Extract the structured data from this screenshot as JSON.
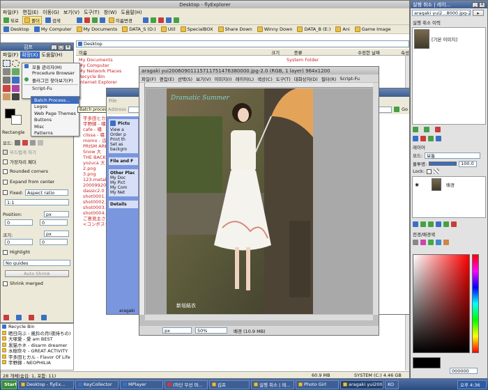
{
  "explorer": {
    "title": "Desktop - flyExplorer",
    "menu": [
      "파일(F)",
      "편집(E)",
      "이동(G)",
      "보기(V)",
      "도구(T)",
      "창(W)",
      "도움말(H)"
    ],
    "toolbar": [
      "뒤로",
      "폴더",
      "검색",
      "이름변경"
    ],
    "favorites": [
      "Desktop",
      "My Computer",
      "My Documents",
      "DATA_S (D:)",
      "Util",
      "SpecialBOX",
      "Share Down",
      "Winny Down",
      "DATA_B (E:)",
      "Ani",
      "Game Image"
    ],
    "address": "Desktop",
    "columns": [
      "이름",
      "크기",
      "종류",
      "수정한 날짜",
      "속성"
    ],
    "first_row_type": "System Folder",
    "files": [
      "My Documents",
      "My Computer",
      "My Network Places",
      "Recycle Bin",
      "Internet Explorer"
    ],
    "lower_files": [
      "宇多田ヒカル",
      "宇野錦 - 嘯",
      "cafe - 嘯",
      "clissa - 嘯",
      "momo - 瓜",
      "PRISM ARK",
      "Snow 大",
      "THE BACK",
      "yozuca 大",
      "2.png",
      "3.png",
      "123-metalo",
      "2000992022",
      "dassic2.0",
      "shot0001.pr",
      "shot0002.pr",
      "shot0003.pr",
      "shot0004.pr",
      "ご意見主さ",
      "<コンボスクリ"
    ],
    "status_left": "28 개체(숨김: 1, 포함: 11)",
    "status_size": "60.9 MB",
    "status_drive": "SYSTEM (C:) 4.46 GB"
  },
  "toolbox": {
    "title": "김프",
    "menu": [
      "파일(F)",
      "확장(X)",
      "도움말(H)"
    ],
    "mode_label": "모드:",
    "antialias": "부드럽게 하기",
    "feather": "가장자리 페더",
    "rounded": "Rounded corners",
    "expand": "Expand from center",
    "fixed_label": "Fixed:",
    "fixed_value": "Aspect ratio",
    "ratio_value": "1:1",
    "position_label": "Position:",
    "size_label": "크기:",
    "unit": "px",
    "zero": "0",
    "highlight": "Highlight",
    "guides": "No guides",
    "auto_shrink": "Auto Shrink",
    "shrink_merged": "Shrink merged",
    "rectangle_label": "Rectangle"
  },
  "xtns_menu": {
    "items": [
      "모듈 관리자(M)",
      "Procedure Browser",
      "플러그인 찾아보기(P)",
      "Script-Fu"
    ],
    "submenu_title": "Batch Process...",
    "sub_items": [
      "Batch Process...",
      "Logos",
      "Web Page Themes",
      "Buttons",
      "Misc",
      "Patterns"
    ],
    "tooltip": "Batch processes multiple images"
  },
  "image_window": {
    "title": "aragaki yui20060901115711751476380000.jpg-2.0 (RGB, 1 layer) 964x1200",
    "menu": [
      "파일(F)",
      "편집(E)",
      "선택(S)",
      "보기(V)",
      "이미지(I)",
      "레이어(L)",
      "색상(C)",
      "도구(T)",
      "대화상자(D)",
      "필터(R)",
      "Script-Fu"
    ],
    "unit": "px",
    "zoom": "50%",
    "status": "배경 (10.9 MB)",
    "photo_caption": "Dramatic Summer",
    "photo_name": "新垣結衣"
  },
  "folder_window": {
    "title_left": "File",
    "address_label": "Address",
    "go_label": "Go",
    "picture_tasks": "Pictu",
    "tasks": [
      "View a",
      "Order p",
      "Print th",
      "Set as backgro"
    ],
    "file_folder": "File and F",
    "other_places": "Other Plac",
    "places": [
      "My Doc",
      "My Pict",
      "My Com",
      "My Net"
    ],
    "details": "Details",
    "footer": "aragaki"
  },
  "tree": [
    "Recycle Bin",
    "晒日向ぶ - 風鈴の月(夜持ちの)",
    "大塚愛 - 愛 am BEST",
    "黒猫ホネ - disarm dreamer",
    "水樹奈々 - GREAT ACTIVITY",
    "宇多田ヒカル - Flavor Of Life",
    "宇野錦 - NEOPHILIA"
  ],
  "layers_panel": {
    "title": "실행 취소 | 레이...",
    "image_name": "aragaki yui2...8000.jpg-2",
    "undo_label": "실행 취소 이력",
    "undo_item": "[기본 이미지]",
    "layer_tab": "레이어",
    "mode_label": "모드:",
    "mode_value": "보통",
    "opacity_label": "불투명:",
    "opacity_value": "100.0",
    "lock_label": "Lock:",
    "layer_name": "배경",
    "colors_label": "전경/배경색",
    "hex_value": "000000"
  },
  "taskbar": {
    "start": "Start",
    "items": [
      "Desktop - flyEx...",
      "KeyCollector",
      "MPlayer",
      "(하단 무선 마...",
      "김프",
      "실행 취소 | 레...",
      "Photo Girl",
      "aragaki yui2006...",
      "KO"
    ],
    "time": "오후 4:36"
  },
  "colors": {
    "accent": "#3b6cc0",
    "title_blue": "#3c5d90",
    "red_text": "#cc2222"
  }
}
